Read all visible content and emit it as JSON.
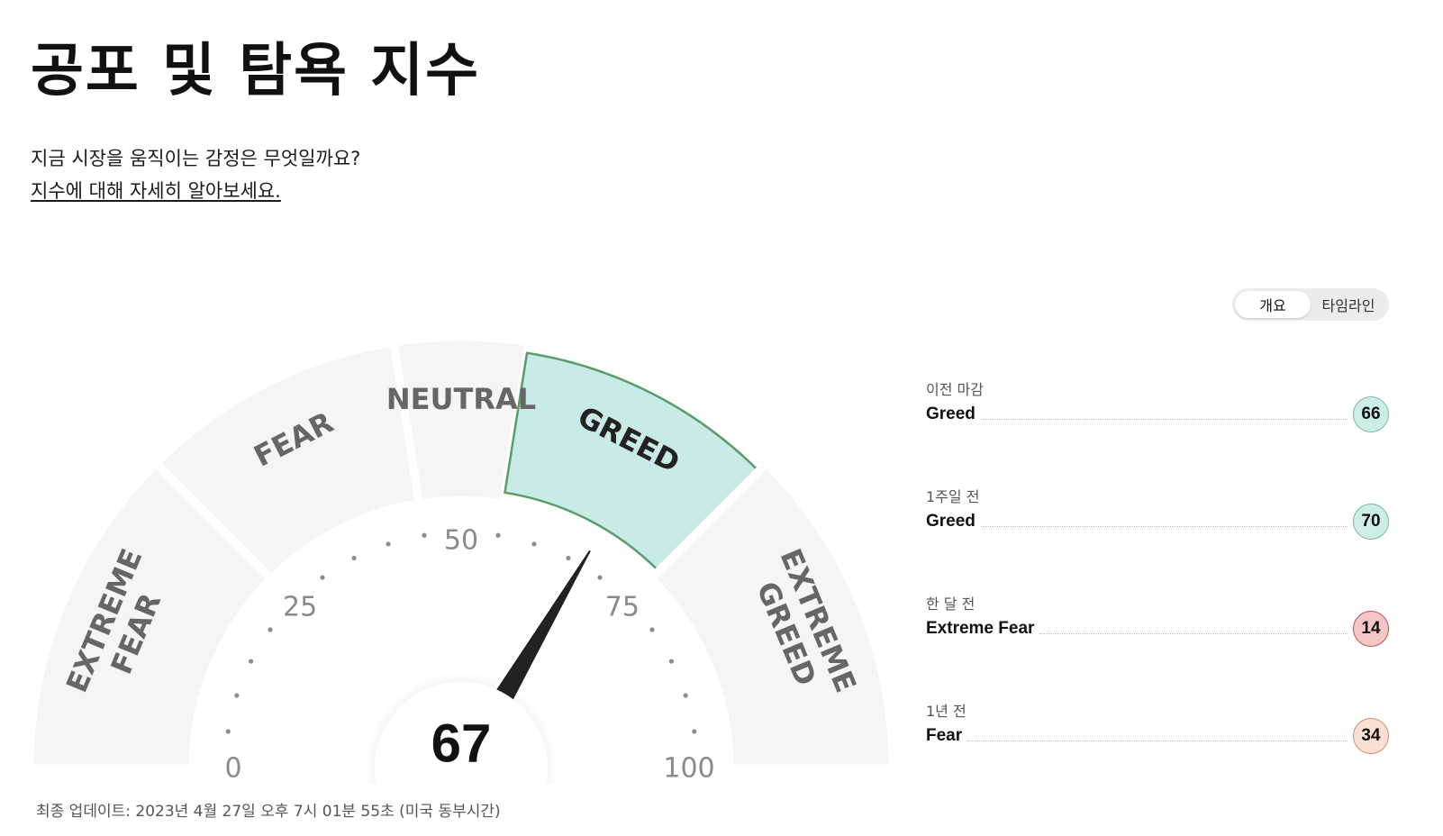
{
  "title": "공포 및 탐욕 지수",
  "subtitle": "지금 시장을 움직이는 감정은 무엇일까요?",
  "learn_more_link": "지수에 대해 자세히 알아보세요.",
  "view_toggle": {
    "overview": "개요",
    "timeline": "타임라인",
    "active": "overview"
  },
  "gauge": {
    "score": 67,
    "min": 0,
    "max": 100,
    "active_zone": "greed",
    "zones": [
      {
        "id": "extreme-fear",
        "lines": [
          "EXTREME",
          "FEAR"
        ],
        "from": 0,
        "to": 25
      },
      {
        "id": "fear",
        "lines": [
          "FEAR"
        ],
        "from": 25,
        "to": 45
      },
      {
        "id": "neutral",
        "lines": [
          "NEUTRAL"
        ],
        "from": 45,
        "to": 55
      },
      {
        "id": "greed",
        "lines": [
          "GREED"
        ],
        "from": 55,
        "to": 75
      },
      {
        "id": "extreme-greed",
        "lines": [
          "EXTREME",
          "GREED"
        ],
        "from": 75,
        "to": 100
      }
    ],
    "scale_labels": [
      "0",
      "25",
      "50",
      "75",
      "100"
    ],
    "colors": {
      "active_fill": "#c8ebe7",
      "active_stroke": "#5a9d67",
      "zone_fill": "#f5f5f5",
      "needle": "#222222",
      "zone_text": "#666666",
      "active_text": "#222222"
    }
  },
  "history": [
    {
      "label": "이전 마감",
      "rating": "Greed",
      "score": "66",
      "color": "#cdeee8",
      "border": "#7cb89a"
    },
    {
      "label": "1주일 전",
      "rating": "Greed",
      "score": "70",
      "color": "#cdeee8",
      "border": "#7cb89a"
    },
    {
      "label": "한 달 전",
      "rating": "Extreme Fear",
      "score": "14",
      "color": "#f4c6c6",
      "border": "#a85a5a"
    },
    {
      "label": "1년 전",
      "rating": "Fear",
      "score": "34",
      "color": "#f9e0d2",
      "border": "#c4946e"
    }
  ],
  "last_updated": "최종 업데이트: 2023년 4월 27일 오후 7시 01분 55초 (미국 동부시간)"
}
